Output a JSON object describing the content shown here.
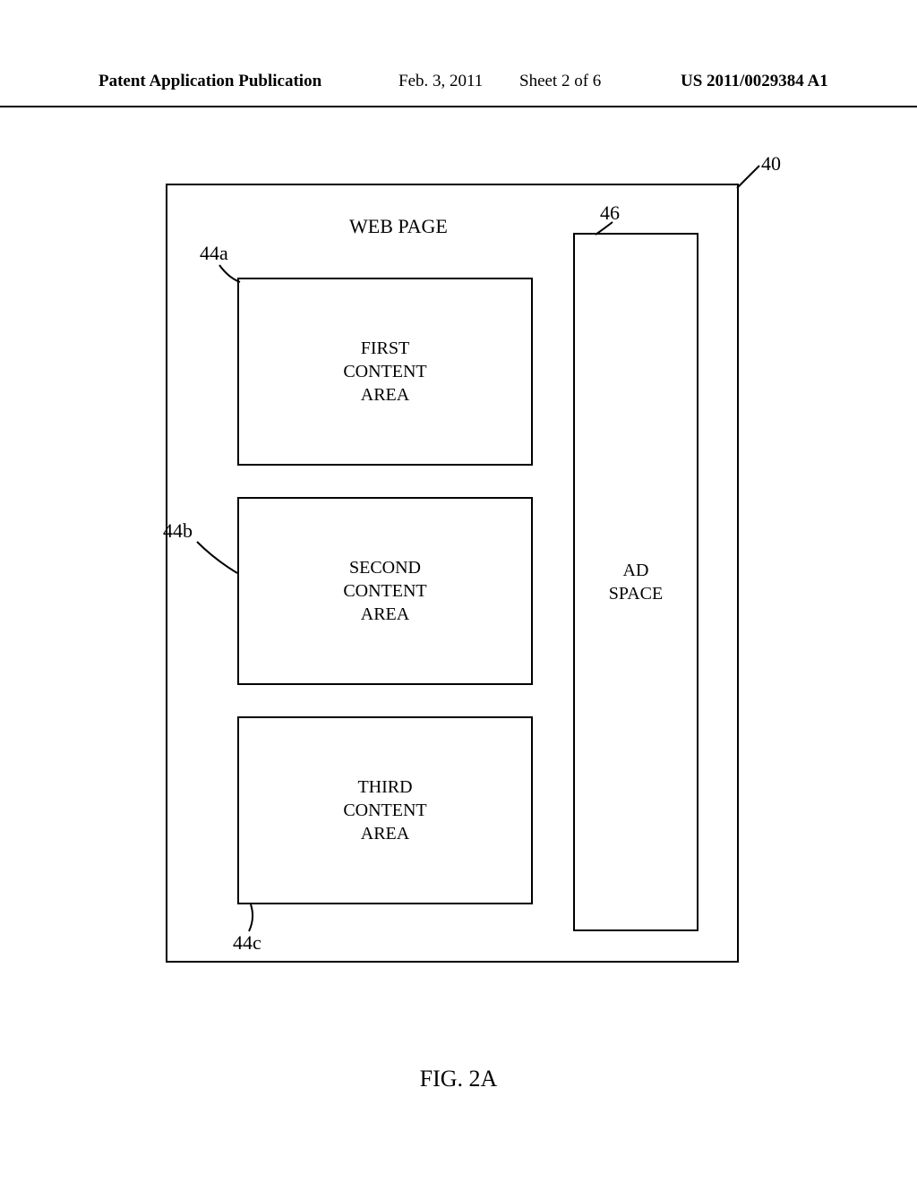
{
  "header": {
    "left": "Patent Application Publication",
    "date": "Feb. 3, 2011",
    "sheet": "Sheet 2 of 6",
    "pubno": "US 2011/0029384 A1"
  },
  "diagram": {
    "title": "WEB PAGE",
    "boxes": {
      "a": "FIRST\nCONTENT\nAREA",
      "b": "SECOND\nCONTENT\nAREA",
      "c": "THIRD\nCONTENT\nAREA",
      "ad": "AD\nSPACE"
    },
    "refs": {
      "outer": "40",
      "a": "44a",
      "b": "44b",
      "c": "44c",
      "ad": "46"
    }
  },
  "figure_caption": "FIG. 2A"
}
